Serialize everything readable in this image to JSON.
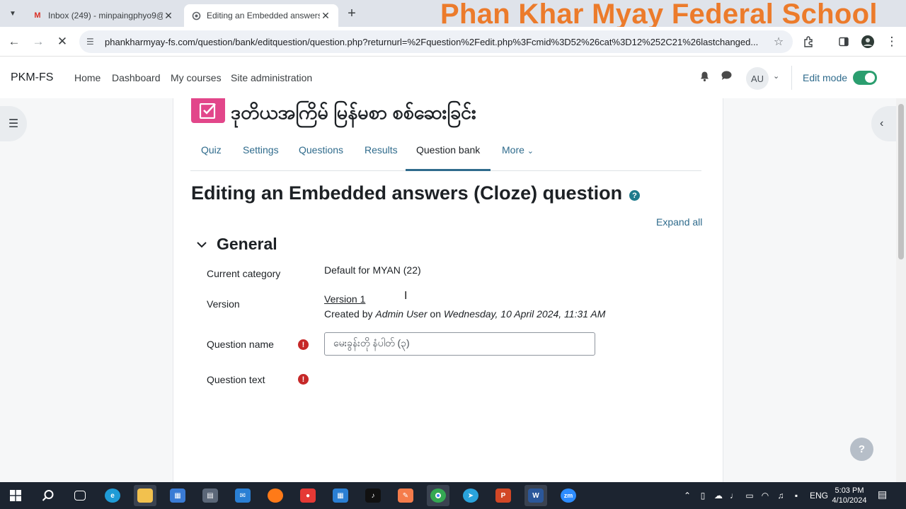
{
  "browser": {
    "tabs": [
      {
        "title": "Inbox (249) - minpaingphyo9@",
        "icon": "gmail-icon"
      },
      {
        "title": "Editing an Embedded answers (",
        "icon": "moodle-icon"
      }
    ],
    "url": "phankharmyay-fs.com/question/bank/editquestion/question.php?returnurl=%2Fquestion%2Fedit.php%3Fcmid%3D52%26cat%3D12%252C21%26lastchanged...",
    "watermark": "Phan Khar Myay Federal School"
  },
  "navbar": {
    "brand": "PKM-FS",
    "links": [
      "Home",
      "Dashboard",
      "My courses",
      "Site administration"
    ],
    "avatar": "AU",
    "edit_mode": "Edit mode",
    "edit_mode_on": true
  },
  "page": {
    "quiz_title": "ဒုတိယအကြိမ် မြန်မစာ စစ်ဆေးခြင်း",
    "tabs": [
      "Quiz",
      "Settings",
      "Questions",
      "Results",
      "Question bank",
      "More"
    ],
    "active_tab": "Question bank",
    "heading": "Editing an Embedded answers (Cloze) question",
    "expand_all": "Expand all",
    "section_title": "General",
    "fields": {
      "current_category_label": "Current category",
      "current_category_value": "Default for MYAN (22)",
      "version_label": "Version",
      "version_value": "Version 1",
      "created_prefix": "Created by ",
      "created_user": "Admin User",
      "created_on": " on ",
      "created_date": "Wednesday, 10 April 2024, 11:31 AM",
      "question_name_label": "Question name",
      "question_name_value": "မေးခွန်းတို နံပါတ် (၃)",
      "question_text_label": "Question text"
    }
  },
  "taskbar": {
    "lang": "ENG",
    "time": "5:03 PM",
    "date": "4/10/2024"
  },
  "colors": {
    "accent": "#2f6b8c",
    "toggle": "#2b9e6f",
    "quiz_icon": "#e2468a",
    "required": "#c62828",
    "watermark": "#ec7b2b"
  }
}
